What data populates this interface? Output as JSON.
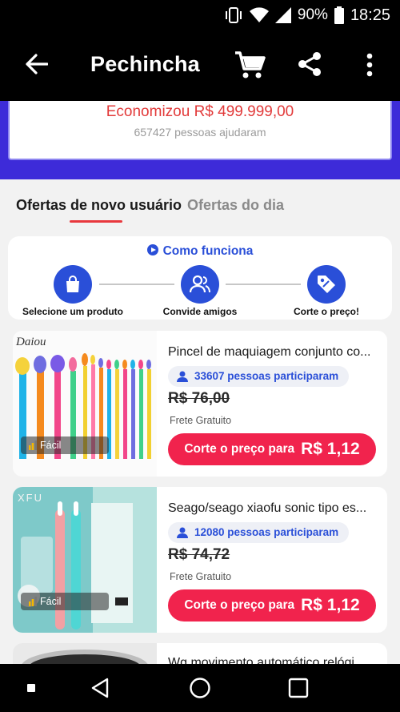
{
  "status_bar": {
    "battery": "90%",
    "time": "18:25"
  },
  "app_bar": {
    "title": "Pechincha"
  },
  "banner": {
    "saved_text": "Economizou R$ 499.999,00",
    "helped_text": "657427 pessoas ajudaram"
  },
  "tabs": [
    {
      "label": "Ofertas de novo usuário",
      "active": true
    },
    {
      "label": "Ofertas do dia",
      "active": false
    }
  ],
  "how_it_works": {
    "title": "Como funciona",
    "steps": [
      {
        "label": "Selecione um produto",
        "icon": "shopping-bag-icon"
      },
      {
        "label": "Convide amigos",
        "icon": "friends-icon"
      },
      {
        "label": "Corte o preço!",
        "icon": "price-tag-icon"
      }
    ]
  },
  "products": [
    {
      "name": "Pincel de maquiagem conjunto co...",
      "participants": "33607 pessoas participaram",
      "old_price": "R$ 76,00",
      "shipping": "Frete Gratuito",
      "cut_label": "Corte o preço para",
      "cut_price": "R$ 1,12",
      "difficulty": "Fácil",
      "brand": "Daiou"
    },
    {
      "name": "Seago/seago xiaofu sonic tipo es...",
      "participants": "12080 pessoas participaram",
      "old_price": "R$ 74,72",
      "shipping": "Frete Gratuito",
      "cut_label": "Corte o preço para",
      "cut_price": "R$ 1,12",
      "difficulty": "Fácil",
      "brand": "XFU"
    },
    {
      "name": "Wg movimento automático relógi..."
    }
  ],
  "colors": {
    "accent_red": "#f1234d",
    "accent_blue": "#2a4fd8",
    "banner_purple": "#3d2bd9"
  }
}
